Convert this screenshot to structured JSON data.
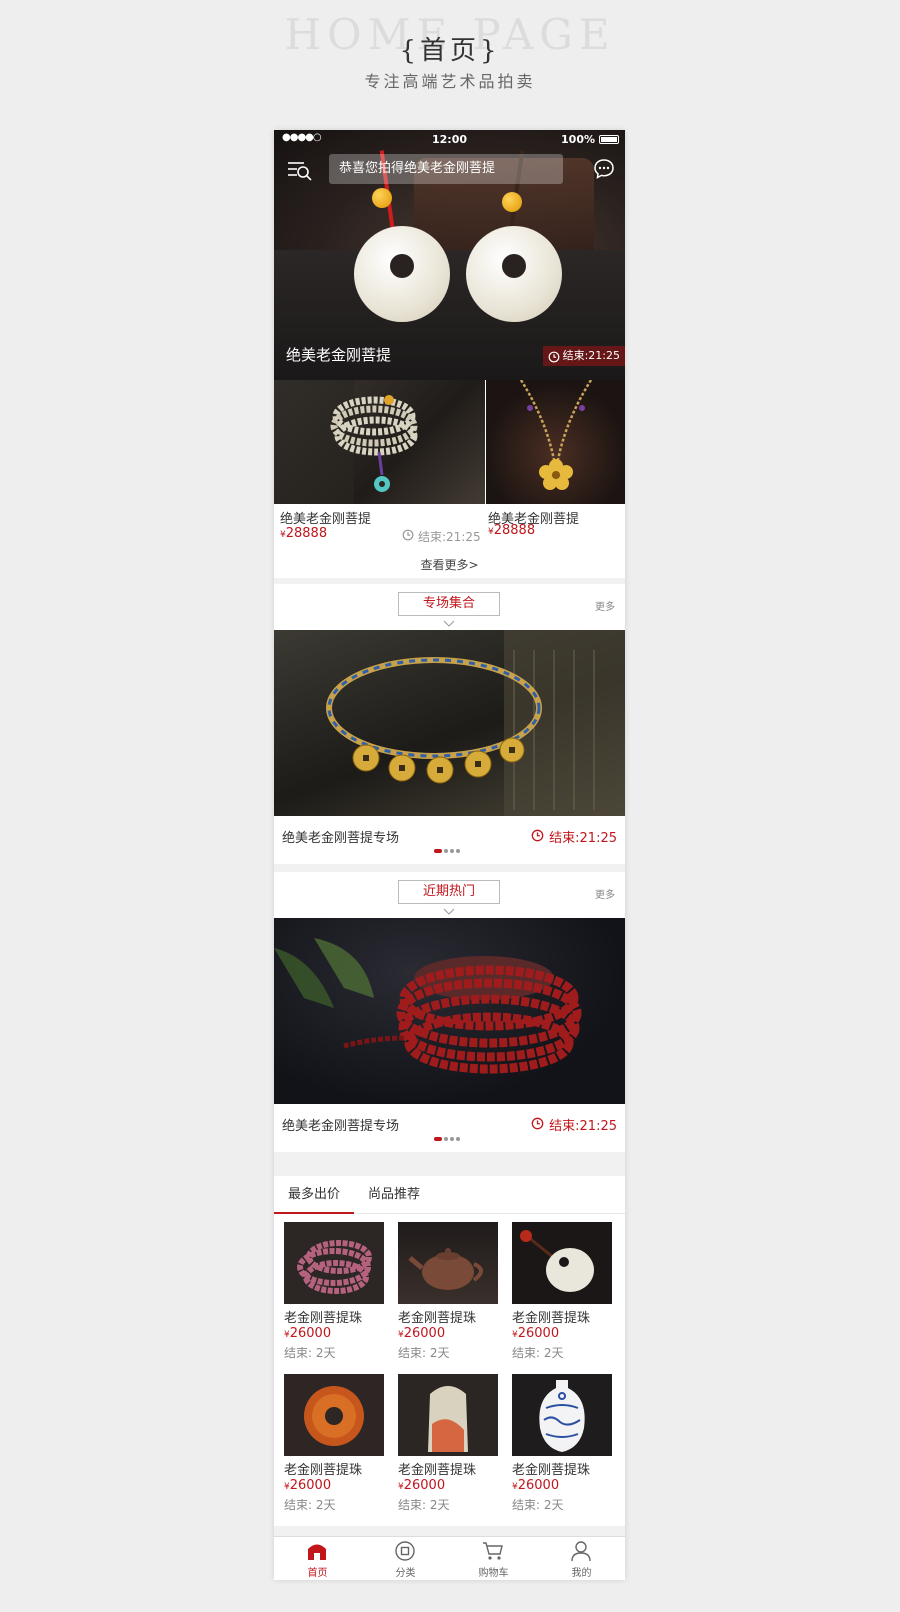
{
  "presentation": {
    "watermark": "HOME PAGE",
    "title": "{首页}",
    "subtitle": "专注高端艺术品拍卖"
  },
  "status_bar": {
    "signal": "●●●●○",
    "time": "12:00",
    "battery": "100%"
  },
  "header": {
    "search_text": "恭喜您拍得绝美老金刚菩提"
  },
  "hero": {
    "title": "绝美老金刚菩提",
    "countdown": "结束:21:25"
  },
  "featured": {
    "items": [
      {
        "name": "绝美老金刚菩提",
        "price": "28888",
        "countdown": "结束:21:25"
      },
      {
        "name": "绝美老金刚菩提",
        "price": "28888"
      }
    ],
    "see_more": "查看更多>"
  },
  "currency_symbol": "¥",
  "sections": [
    {
      "heading": "专场集合",
      "more": "更多",
      "caption": "绝美老金刚菩提专场",
      "countdown": "结束:21:25"
    },
    {
      "heading": "近期热门",
      "more": "更多",
      "caption": "绝美老金刚菩提专场",
      "countdown": "结束:21:25"
    }
  ],
  "tabs": [
    "最多出价",
    "尚品推荐"
  ],
  "grid": [
    {
      "name": "老金刚菩提珠",
      "price": "26000",
      "time": "结束: 2天"
    },
    {
      "name": "老金刚菩提珠",
      "price": "26000",
      "time": "结束: 2天"
    },
    {
      "name": "老金刚菩提珠",
      "price": "26000",
      "time": "结束: 2天"
    },
    {
      "name": "老金刚菩提珠",
      "price": "26000",
      "time": "结束: 2天"
    },
    {
      "name": "老金刚菩提珠",
      "price": "26000",
      "time": "结束: 2天"
    },
    {
      "name": "老金刚菩提珠",
      "price": "26000",
      "time": "结束: 2天"
    }
  ],
  "tab_bar": [
    {
      "label": "首页",
      "icon": "home-icon"
    },
    {
      "label": "分类",
      "icon": "category-icon"
    },
    {
      "label": "购物车",
      "icon": "cart-icon"
    },
    {
      "label": "我的",
      "icon": "profile-icon"
    }
  ],
  "colors": {
    "accent": "#c1161c",
    "background": "#eeeeee"
  }
}
